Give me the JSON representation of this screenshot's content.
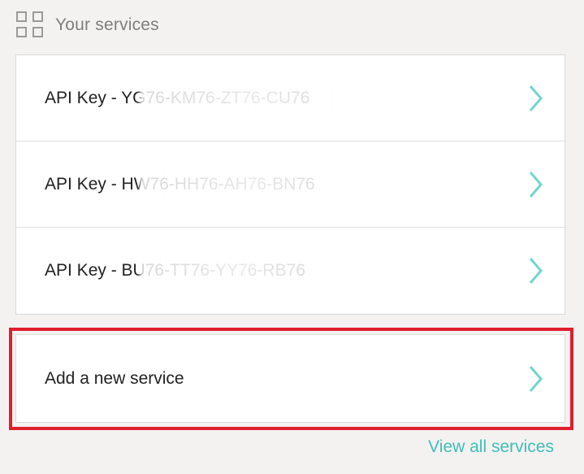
{
  "header": {
    "title": "Your services",
    "icon": "grid-icon"
  },
  "services": [
    {
      "prefix": "API Key - ",
      "key": "YG76-KM76-ZT76-CU76"
    },
    {
      "prefix": "API Key - ",
      "key": "HW76-HH76-AH76-BN76"
    },
    {
      "prefix": "API Key - ",
      "key": "BU76-TT76-YY76-RB76"
    }
  ],
  "add_service": {
    "label": "Add a new service"
  },
  "view_all": {
    "label": "View all services"
  },
  "colors": {
    "accent": "#3fbfb8",
    "chevron": "#71d4cf",
    "highlight": "#e01e2c",
    "background": "#f3f2f1"
  }
}
